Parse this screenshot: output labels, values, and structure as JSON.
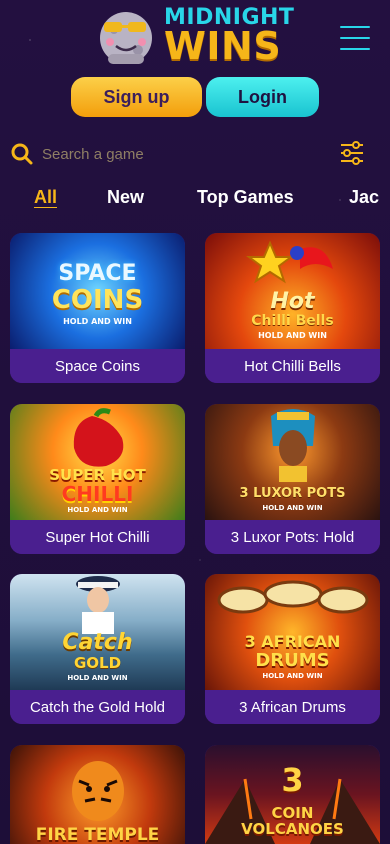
{
  "brand": {
    "line1": "MIDNIGHT",
    "line2": "WINS"
  },
  "auth": {
    "signup_label": "Sign up",
    "login_label": "Login"
  },
  "search": {
    "placeholder": "Search a game"
  },
  "tabs": [
    {
      "label": "All",
      "active": true
    },
    {
      "label": "New",
      "active": false
    },
    {
      "label": "Top Games",
      "active": false
    },
    {
      "label": "Jac",
      "active": false
    }
  ],
  "games": [
    {
      "name": "Space Coins",
      "art_line1": "SPACE",
      "art_line2": "COINS",
      "art_sub": "HOLD AND WIN"
    },
    {
      "name": "Hot Chilli Bells",
      "art_line1": "Hot",
      "art_line2": "Chilli Bells",
      "art_sub": "HOLD AND WIN"
    },
    {
      "name": "Super Hot Chilli",
      "art_line1": "SUPER HOT",
      "art_line2": "CHILLI",
      "art_sub": "HOLD AND WIN"
    },
    {
      "name": "3 Luxor Pots: Hold",
      "art_line1": "3 LUXOR POTS",
      "art_line2": "",
      "art_sub": "HOLD AND WIN"
    },
    {
      "name": "Catch the Gold Hold",
      "art_line1": "Catch",
      "art_line2": "GOLD",
      "art_sub": "HOLD AND WIN"
    },
    {
      "name": "3 African Drums",
      "art_line1": "3 AFRICAN",
      "art_line2": "DRUMS",
      "art_sub": "HOLD AND WIN"
    },
    {
      "name": "",
      "art_line1": "FIRE TEMPLE",
      "art_line2": "",
      "art_sub": ""
    },
    {
      "name": "",
      "art_line1": "3",
      "art_line2": "COIN VOLCANOES",
      "art_sub": ""
    }
  ],
  "colors": {
    "background": "#1f0f3a",
    "accent_gold": "#f6b619",
    "accent_cyan": "#29d6e8",
    "card_label_bg": "#4a1f8f"
  }
}
